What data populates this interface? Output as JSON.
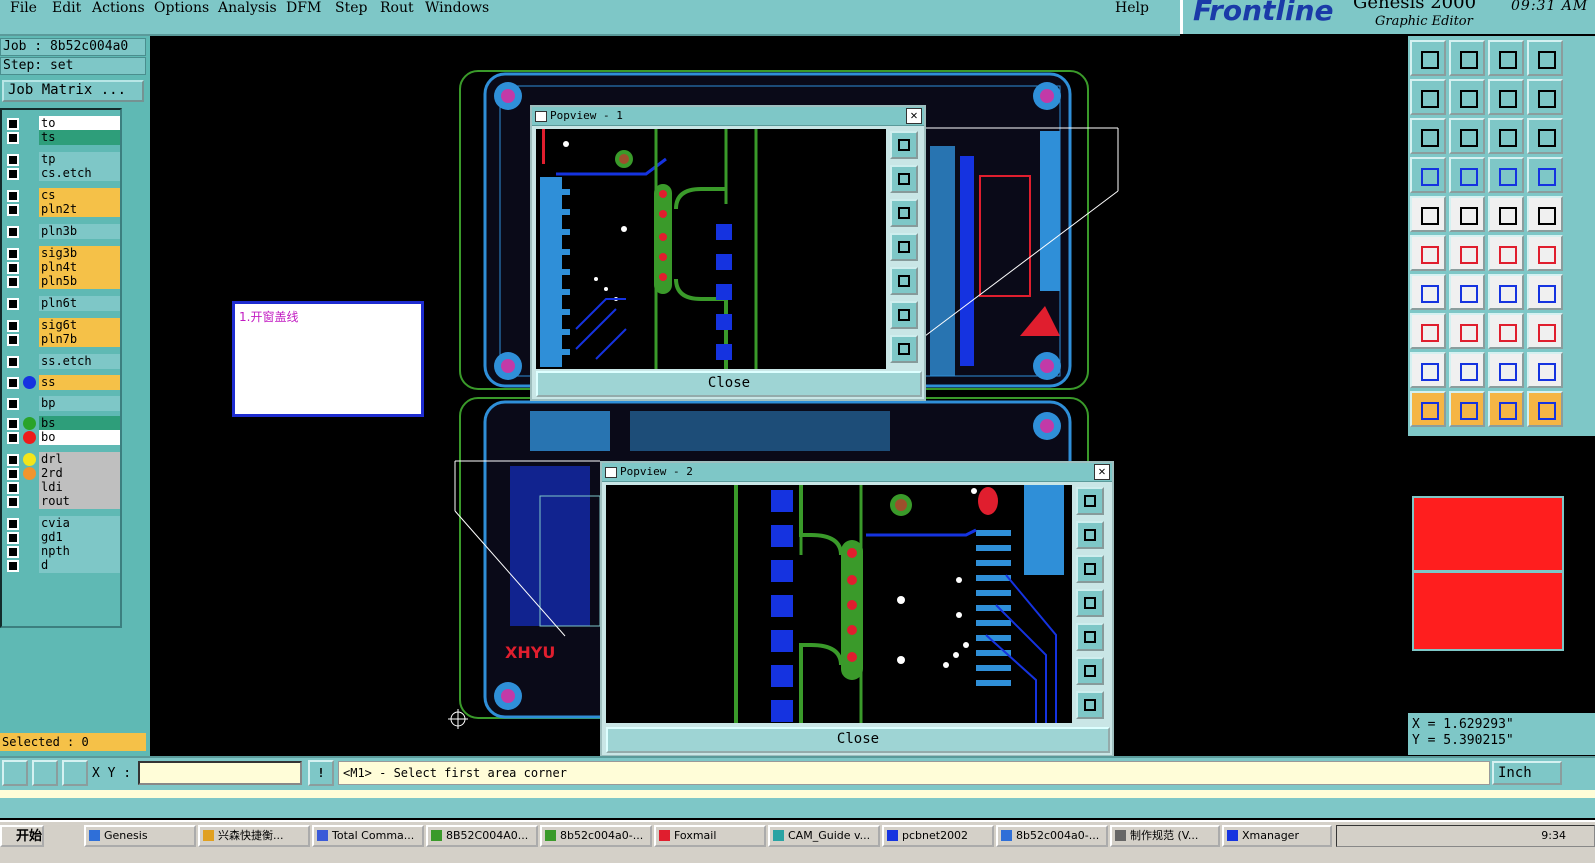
{
  "menu": [
    "File",
    "Edit",
    "Actions",
    "Options",
    "Analysis",
    "DFM",
    "Step",
    "Rout",
    "Windows"
  ],
  "help": "Help",
  "brand": {
    "logo": "Frontline",
    "product": "Genesis 2000",
    "subtitle": "Graphic Editor",
    "clock": "09:31 AM"
  },
  "job": "Job : 8b52c004a0",
  "step": "Step: set",
  "job_matrix": "Job Matrix ...",
  "layers": [
    {
      "name": "to",
      "color": "#ffffff",
      "dot": ""
    },
    {
      "name": "ts",
      "color": "#2e9e7a",
      "dot": ""
    },
    {
      "name": "tp",
      "color": "#7ec7c7",
      "dot": ""
    },
    {
      "name": "cs.etch",
      "color": "#7ec7c7",
      "dot": ""
    },
    {
      "name": "cs",
      "color": "#f5c148",
      "dot": ""
    },
    {
      "name": "pln2t",
      "color": "#f5c148",
      "dot": ""
    },
    {
      "name": "pln3b",
      "color": "#7ec7c7",
      "dot": ""
    },
    {
      "name": "sig3b",
      "color": "#f5c148",
      "dot": ""
    },
    {
      "name": "pln4t",
      "color": "#f5c148",
      "dot": ""
    },
    {
      "name": "pln5b",
      "color": "#f5c148",
      "dot": ""
    },
    {
      "name": "pln6t",
      "color": "#7ec7c7",
      "dot": ""
    },
    {
      "name": "sig6t",
      "color": "#f5c148",
      "dot": ""
    },
    {
      "name": "pln7b",
      "color": "#f5c148",
      "dot": ""
    },
    {
      "name": "ss.etch",
      "color": "#7ec7c7",
      "dot": ""
    },
    {
      "name": "ss",
      "color": "#f5c148",
      "dot": "#1533e0"
    },
    {
      "name": "bp",
      "color": "#7ec7c7",
      "dot": ""
    },
    {
      "name": "bs",
      "color": "#2e9e7a",
      "dot": "#2aa32a"
    },
    {
      "name": "bo",
      "color": "#ffffff",
      "dot": "#ee1b1b"
    },
    {
      "name": "drl",
      "color": "#bfbfbf",
      "dot": "#f4e51b"
    },
    {
      "name": "2rd",
      "color": "#bfbfbf",
      "dot": "#f2952d"
    },
    {
      "name": "ldi",
      "color": "#bfbfbf",
      "dot": ""
    },
    {
      "name": "rout",
      "color": "#bfbfbf",
      "dot": ""
    },
    {
      "name": "cvia",
      "color": "#7ec7c7",
      "dot": ""
    },
    {
      "name": "gd1",
      "color": "#7ec7c7",
      "dot": ""
    },
    {
      "name": "npth",
      "color": "#7ec7c7",
      "dot": ""
    },
    {
      "name": "d",
      "color": "#7ec7c7",
      "dot": ""
    }
  ],
  "selected": "Selected : 0",
  "note": "1.开窗盖线",
  "popups": [
    {
      "title": "Popview - 1",
      "close": "Close"
    },
    {
      "title": "Popview - 2",
      "close": "Close"
    }
  ],
  "coords": {
    "x": "X =  1.629293\"",
    "y": "Y =  5.390215\""
  },
  "command": {
    "xy_label": "X Y :",
    "xy_value": "",
    "prompt": "<M1> - Select first area corner",
    "unit": "Inch"
  },
  "taskbar": {
    "start": "开始",
    "tasks": [
      "Genesis",
      "兴森快捷衡...",
      "Total Comma...",
      "8B52C004A0...",
      "8b52c004a0-...",
      "Foxmail",
      "CAM_Guide v...",
      "pcbnet2002",
      "8b52c004a0-...",
      "制作规范 (V...",
      "Xmanager"
    ],
    "time": "9:34"
  },
  "colors": {
    "panel": "#7ec7c7",
    "accent": "#f5c148",
    "board_blue": "#2f8fd8",
    "trace_green": "#3a9a2a",
    "pad_red": "#e01e2e"
  }
}
